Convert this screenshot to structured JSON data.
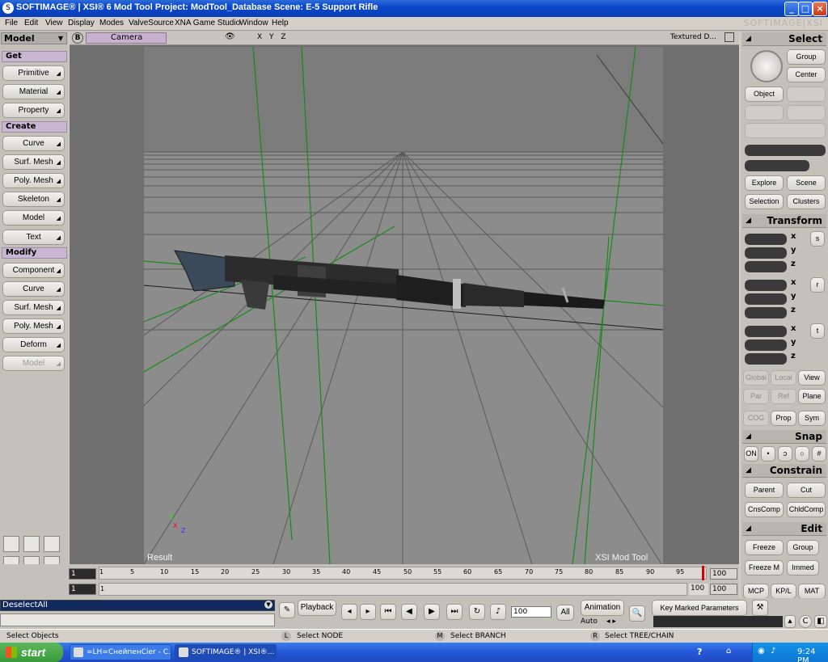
{
  "window": {
    "title": "SOFTIMAGE® | XSI® 6 Mod Tool Project: ModTool_Database     Scene: E-5 Support Rifle",
    "brand": "SOFTIMAGE|XSI"
  },
  "menu": [
    "File",
    "Edit",
    "View",
    "Display",
    "Modes",
    "ValveSource",
    "XNA Game Studio",
    "Window",
    "Help"
  ],
  "left_panel": {
    "mode": "Model",
    "get_label": "Get",
    "get_items": [
      "Primitive",
      "Material",
      "Property"
    ],
    "create_label": "Create",
    "create_items": [
      "Curve",
      "Surf. Mesh",
      "Poly. Mesh",
      "Skeleton",
      "Model",
      "Text"
    ],
    "modify_label": "Modify",
    "modify_items": [
      "Component",
      "Curve",
      "Surf. Mesh",
      "Poly. Mesh",
      "Deform",
      "Model"
    ]
  },
  "viewport": {
    "b_button": "B",
    "camera": "Camera",
    "xyz": "X Y Z",
    "display_mode": "Textured D...",
    "label_result": "Result",
    "label_brand": "XSI Mod Tool",
    "axis_x": "X",
    "axis_y": "Y",
    "axis_z": "Z"
  },
  "right_panel": {
    "select_header": "Select",
    "select_buttons": [
      "Group",
      "Center",
      "Object"
    ],
    "explore_buttons": [
      "Explore",
      "Scene",
      "Selection",
      "Clusters"
    ],
    "transform_header": "Transform",
    "transform_letters": [
      "s",
      "r",
      "t"
    ],
    "axes": [
      "x",
      "y",
      "z"
    ],
    "space_buttons": [
      "Global",
      "Local",
      "View",
      "Par",
      "Ref",
      "Plane"
    ],
    "cog_buttons": [
      "COG",
      "Prop",
      "Sym"
    ],
    "snap_header": "Snap",
    "snap_on": "ON",
    "constrain_header": "Constrain",
    "constrain_buttons": [
      "Parent",
      "Cut",
      "CnsComp",
      "ChldComp"
    ],
    "edit_header": "Edit",
    "edit_buttons": [
      "Freeze",
      "Group",
      "Freeze M",
      "Immed"
    ],
    "tabs": [
      "MCP",
      "KP/L",
      "MAT"
    ]
  },
  "timeline": {
    "start_frame": "1",
    "start_frame2": "1",
    "end_label": "1",
    "end_frame": "100",
    "end_frame2": "100",
    "end_frame2_left": "100",
    "ticks": [
      "1",
      "5",
      "10",
      "15",
      "20",
      "25",
      "30",
      "35",
      "40",
      "45",
      "50",
      "55",
      "60",
      "65",
      "70",
      "75",
      "80",
      "85",
      "90",
      "95"
    ]
  },
  "command_bar": {
    "command": "DeselectAll",
    "playback": "Playback",
    "frame_value": "100",
    "all": "All",
    "animation": "Animation",
    "auto": "Auto",
    "key_marked": "Key Marked Parameters"
  },
  "status": {
    "left": "Select Objects",
    "l_key": "L",
    "l_text": "Select NODE",
    "m_key": "M",
    "m_text": "Select BRANCH",
    "r_key": "R",
    "r_text": "Select TREE/CHAIN"
  },
  "taskbar": {
    "start": "start",
    "tasks": [
      "=LH=CнейпенCier - C...",
      "SOFTIMAGE® | XSI®..."
    ],
    "time": "9:24 PM"
  },
  "colors": {
    "title_bar": "#0a47c9",
    "section": "#c9b6d1",
    "grid": "#555555",
    "green_lines": "#1a8a1a",
    "playhead": "#d40000"
  }
}
